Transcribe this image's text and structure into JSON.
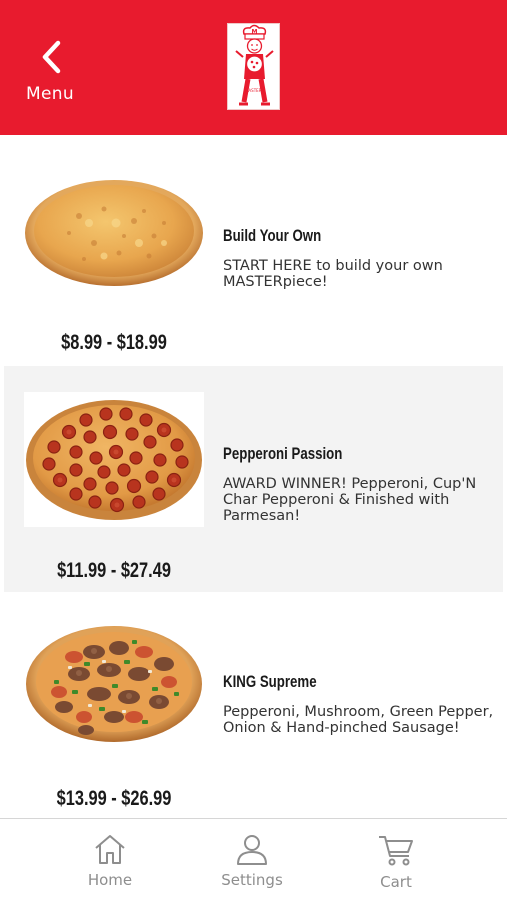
{
  "header": {
    "back_label": "Menu",
    "brand_color": "#e81b2e",
    "logo_text": "MASTERS"
  },
  "menu_items": [
    {
      "name": "Build Your Own",
      "description": "START HERE to build your own MASTERpiece!",
      "price": "$8.99 - $18.99",
      "image": "cheese-pizza"
    },
    {
      "name": "Pepperoni Passion",
      "description": "AWARD WINNER! Pepperoni, Cup'N Char Pepperoni & Finished with Parmesan!",
      "price": "$11.99 - $27.49",
      "image": "pepperoni-pizza"
    },
    {
      "name": "KING Supreme",
      "description": "Pepperoni, Mushroom, Green Pepper, Onion & Hand-pinched Sausage!",
      "price": "$13.99 - $26.99",
      "image": "supreme-pizza"
    }
  ],
  "tabbar": {
    "tabs": [
      {
        "label": "Home",
        "icon": "home-icon"
      },
      {
        "label": "Settings",
        "icon": "person-icon"
      },
      {
        "label": "Cart",
        "icon": "cart-icon"
      }
    ]
  }
}
